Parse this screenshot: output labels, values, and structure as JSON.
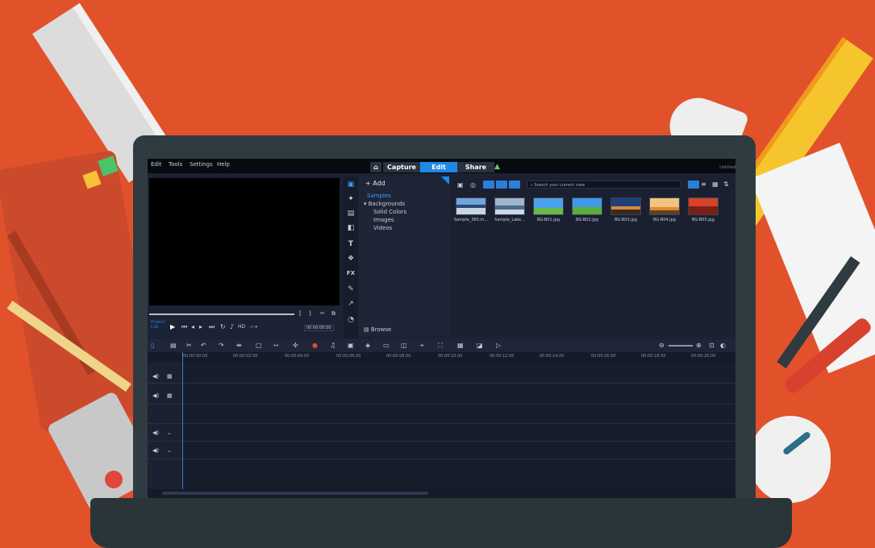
{
  "menu": {
    "items": [
      "Edit",
      "Tools",
      "Settings",
      "Help"
    ]
  },
  "tabs": {
    "capture": "Capture",
    "edit": "Edit",
    "share": "Share"
  },
  "window_title": "Untitled",
  "preview": {
    "project_label_1": "Project-",
    "project_label_2": "Clip",
    "timecode": "00:00:00:00"
  },
  "library": {
    "add_label": "Add",
    "tree": [
      "Samples",
      "Backgrounds",
      "Solid Colors",
      "Images",
      "Videos"
    ],
    "browse_label": "Browse",
    "search_placeholder": "Search your current view",
    "thumbs": [
      "Sample_360.m...",
      "Sample_Lake...",
      "BG-B01.jpg",
      "BG-B02.jpg",
      "BG-B03.jpg",
      "BG-B04.jpg",
      "BG-B05.jpg"
    ]
  },
  "timeline": {
    "ruler": [
      "00:00:00.00",
      "00:00:02.00",
      "00:00:04.00",
      "00:00:06.00",
      "00:00:08.00",
      "00:00:10.00",
      "00:00:12.00",
      "00:00:14.00",
      "00:00:16.00",
      "00:00:18.00",
      "00:00:20.00"
    ]
  },
  "colors": {
    "background": "#e1522b",
    "accent": "#1e88e5",
    "panel": "#1b2233"
  }
}
